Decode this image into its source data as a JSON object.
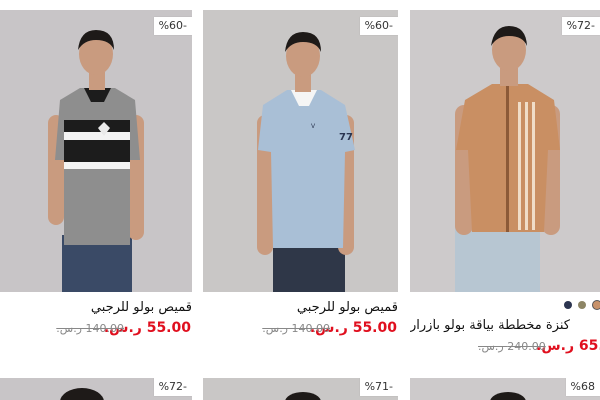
{
  "products": [
    {
      "discount": "%60-",
      "title": "قميص بولو للرجبي",
      "price": "55.00 ر.س.",
      "old_price": "140.00 ر.س.",
      "colors": {
        "bg": "#c8c5c7",
        "shirt": "#8e8e8e",
        "stripe": "#1c1c1c",
        "pants": "#3a4a66"
      }
    },
    {
      "discount": "%60-",
      "title": "قميص بولو للرجبي",
      "price": "55.00 ر.س.",
      "old_price": "140.00 ر.س.",
      "colors": {
        "bg": "#c9c7c6",
        "shirt": "#a9bfd6",
        "pants": "#2f3748"
      }
    },
    {
      "discount": "%72-",
      "title": "كنزة مخططة بياقة بولو بأزرار",
      "price": "65.00 ر.س.",
      "old_price": "240.00 ر.س.",
      "swatches": [
        "#c8926a",
        "#8d8565",
        "#2c3550"
      ],
      "colors": {
        "bg": "#cdcacb",
        "shirt": "#c98f63",
        "pants": "#b7c6d2"
      }
    }
  ],
  "second_row": [
    {
      "discount": "%72-"
    },
    {
      "discount": "%71-"
    },
    {
      "discount": "%68"
    }
  ]
}
